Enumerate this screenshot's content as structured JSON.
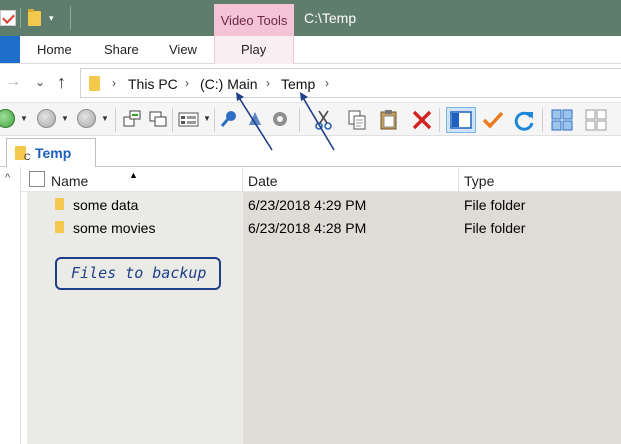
{
  "title_bar": {
    "context_tab_label": "Video Tools",
    "window_title": "C:\\Temp",
    "quick_access_dropdown": "▾"
  },
  "ribbon": {
    "tabs": [
      {
        "label": "Home"
      },
      {
        "label": "Share"
      },
      {
        "label": "View"
      },
      {
        "label": "Play"
      }
    ]
  },
  "navigation": {
    "back": "→",
    "recent": "⌄",
    "up": "↑"
  },
  "address_bar": {
    "crumbs": [
      "This PC",
      "(C:) Main",
      "Temp"
    ],
    "separator": "›"
  },
  "folder_tab": {
    "label": "Temp",
    "drive_letter": "C"
  },
  "file_list": {
    "columns": [
      "Name",
      "Date",
      "Type"
    ],
    "sort_indicator": "▲",
    "rows": [
      {
        "name": "some data",
        "date": "6/23/2018 4:29 PM",
        "type": "File folder"
      },
      {
        "name": "some movies",
        "date": "6/23/2018 4:28 PM",
        "type": "File folder"
      }
    ]
  },
  "scroll": {
    "up": "^"
  },
  "annotation": {
    "text": "Files to backup"
  },
  "colors": {
    "title_bar": "#5f7d6d",
    "context_tab": "#f4c3d5",
    "file_tab": "#1e6fc9",
    "annotation": "#1f3f8a",
    "delete_red": "#d42222",
    "check_orange": "#ee7a1a",
    "refresh_blue": "#1e88d6"
  },
  "icons": [
    "checkbox-icon",
    "folder-icon",
    "back-arrow-icon",
    "up-arrow-icon",
    "green-go-icon",
    "gray-circle-icon",
    "view-mode-icon",
    "pin-icon",
    "gear-icon",
    "cut-icon",
    "copy-icon",
    "paste-icon",
    "delete-icon",
    "preview-pane-icon",
    "checkmark-icon",
    "refresh-icon",
    "large-icons-icon",
    "grid-icon"
  ]
}
